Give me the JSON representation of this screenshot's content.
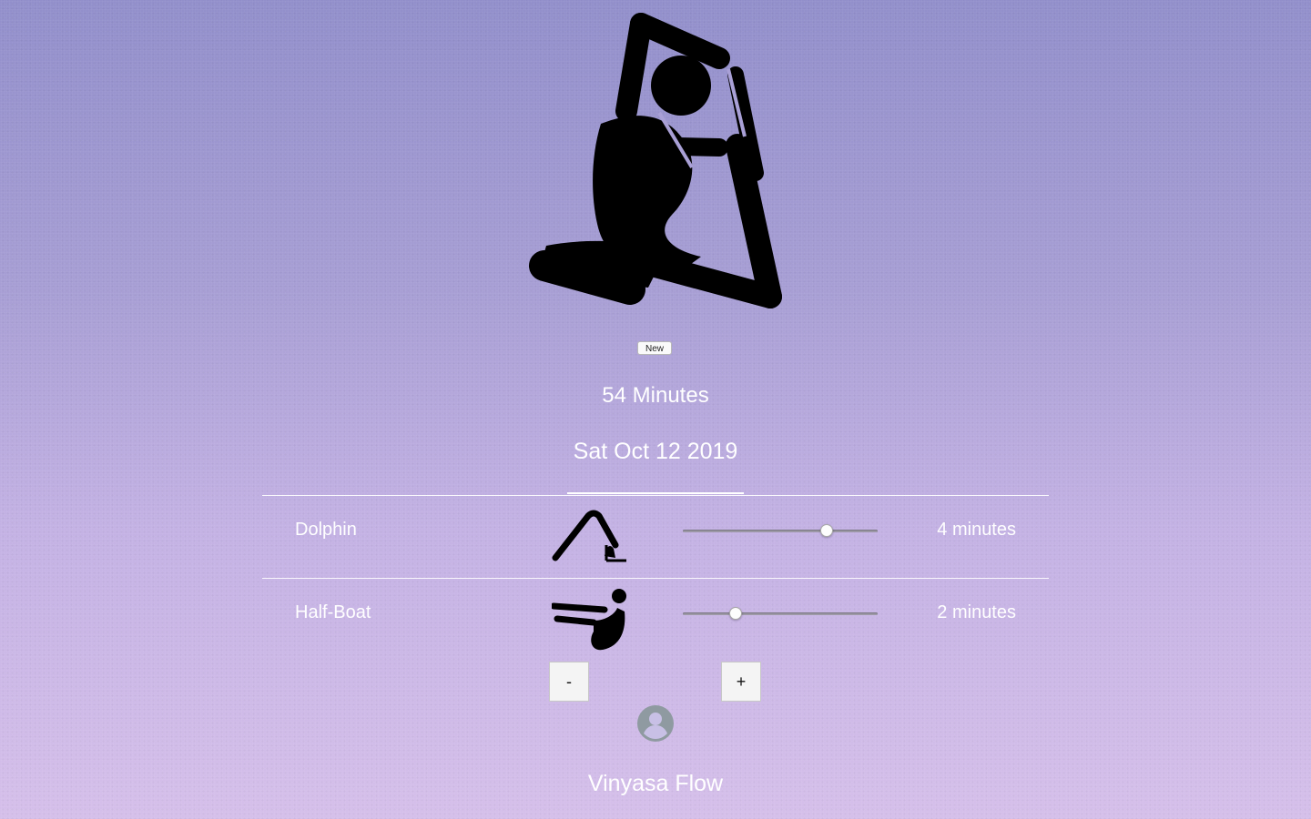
{
  "session": {
    "badge_label": "New",
    "duration": "54 Minutes",
    "date": "Sat Oct 12 2019",
    "flow_name": "Vinyasa Flow"
  },
  "poses": [
    {
      "name": "Dolphin",
      "icon": "dolphin-pose-icon",
      "minutes": 4,
      "minutes_label": "4 minutes",
      "slider_level": 0.74
    },
    {
      "name": "Half-Boat",
      "icon": "half-boat-pose-icon",
      "minutes": 2,
      "minutes_label": "2 minutes",
      "slider_level": 0.27
    }
  ],
  "stepper": {
    "minus_label": "-",
    "plus_label": "+"
  },
  "icons": {
    "hero": "king-pigeon-pose-icon",
    "avatar": "account-circle-icon"
  },
  "colors": {
    "background_top": "#928fcb",
    "background_bottom": "#d5bfea",
    "text": "#ffffff",
    "icon": "#000000",
    "avatar": "#8f9aa1"
  }
}
